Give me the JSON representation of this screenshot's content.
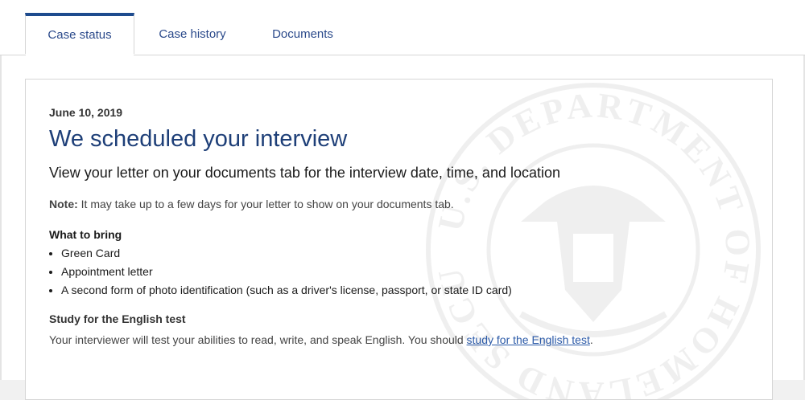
{
  "tabs": [
    {
      "label": "Case status",
      "active": true
    },
    {
      "label": "Case history",
      "active": false
    },
    {
      "label": "Documents",
      "active": false
    }
  ],
  "status": {
    "date": "June 10, 2019",
    "title": "We scheduled your interview",
    "subtitle": "View your letter on your documents tab for the interview date, time, and location",
    "note_label": "Note:",
    "note_text": " It may take up to a few days for your letter to show on your documents tab."
  },
  "bring": {
    "heading": "What to bring",
    "items": [
      "Green Card",
      "Appointment letter",
      "A second form of photo identification (such as a driver's license, passport, or state ID card)"
    ]
  },
  "study": {
    "heading": "Study for the English test",
    "text": "Your interviewer will test your abilities to read, write, and speak English. You should ",
    "link": "study for the English test",
    "after": "."
  },
  "seal": {
    "text": "U.S. DEPARTMENT OF HOMELAND SECURITY"
  },
  "colors": {
    "accent": "#1e4b8e",
    "title": "#1e3f78",
    "link": "#2b5aa8"
  }
}
